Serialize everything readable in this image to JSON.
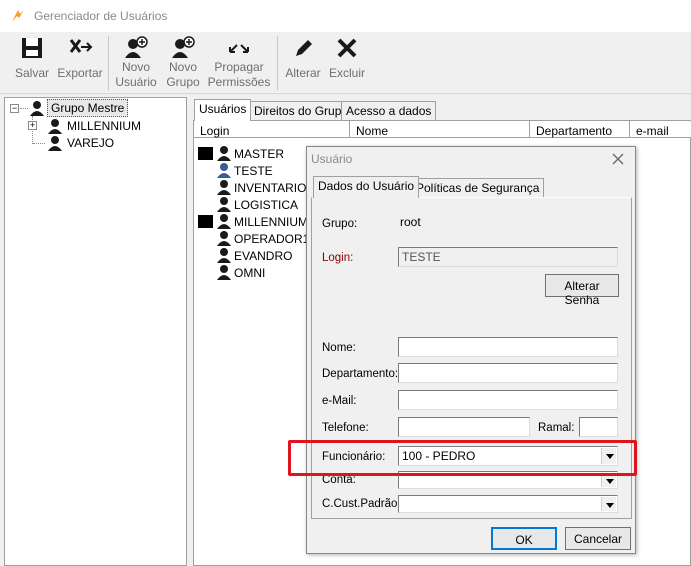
{
  "window": {
    "title": "Gerenciador de Usuários"
  },
  "toolbar": {
    "salvar": "Salvar",
    "exportar": "Exportar",
    "novo_usuario": [
      "Novo",
      "Usuário"
    ],
    "novo_grupo": [
      "Novo",
      "Grupo"
    ],
    "propagar": [
      "Propagar",
      "Permissões"
    ],
    "alterar": "Alterar",
    "excluir": "Excluir"
  },
  "tree": {
    "root": "Grupo Mestre",
    "children": [
      "MILLENNIUM",
      "VAREJO"
    ]
  },
  "tabs": [
    "Usuários",
    "Direitos do Grupo",
    "Acesso a dados"
  ],
  "columns": [
    "Login",
    "Nome",
    "Departamento",
    "e-mail"
  ],
  "users": [
    "MASTER",
    "TESTE",
    "INVENTARIO",
    "LOGISTICA",
    "MILLENNIUM",
    "OPERADOR1",
    "EVANDRO",
    "OMNI"
  ],
  "dialog": {
    "title": "Usuário",
    "tabs": [
      "Dados do Usuário",
      "Políticas de Segurança"
    ],
    "grupo_label": "Grupo:",
    "grupo_value": "root",
    "login_label": "Login:",
    "login_value": "TESTE",
    "alterar_senha": "Alterar Senha",
    "nome_label": "Nome:",
    "depto_label": "Departamento:",
    "email_label": "e-Mail:",
    "telefone_label": "Telefone:",
    "ramal_label": "Ramal:",
    "funcionario_label": "Funcionário:",
    "funcionario_value": "100 - PEDRO",
    "conta_label": "Conta:",
    "ccusto_label": "C.Cust.Padrão:",
    "ok": "OK",
    "cancelar": "Cancelar"
  },
  "colors": {
    "highlight_box": "#e0141e",
    "login_label": "#8b0000",
    "app_icon": "#f0a020"
  }
}
